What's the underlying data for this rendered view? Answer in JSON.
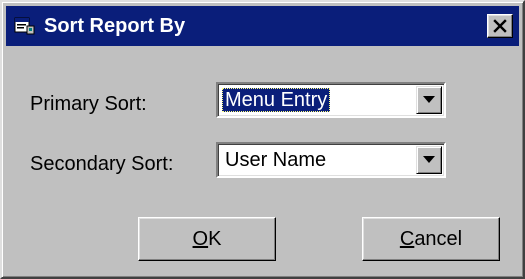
{
  "window": {
    "title": "Sort Report By",
    "close_label": "×"
  },
  "form": {
    "primary": {
      "label": "Primary Sort:",
      "value": "Menu Entry"
    },
    "secondary": {
      "label": "Secondary Sort:",
      "value": "User Name"
    }
  },
  "buttons": {
    "ok": {
      "mnemonic": "O",
      "rest": "K"
    },
    "cancel": {
      "mnemonic": "C",
      "rest": "ancel"
    }
  },
  "colors": {
    "titlebar": "#0a1e7a",
    "face": "#c0c0c0",
    "selection": "#0a1e7a"
  },
  "icons": {
    "title": "report-window-icon",
    "close": "close-icon",
    "dropdown": "chevron-down-icon"
  }
}
